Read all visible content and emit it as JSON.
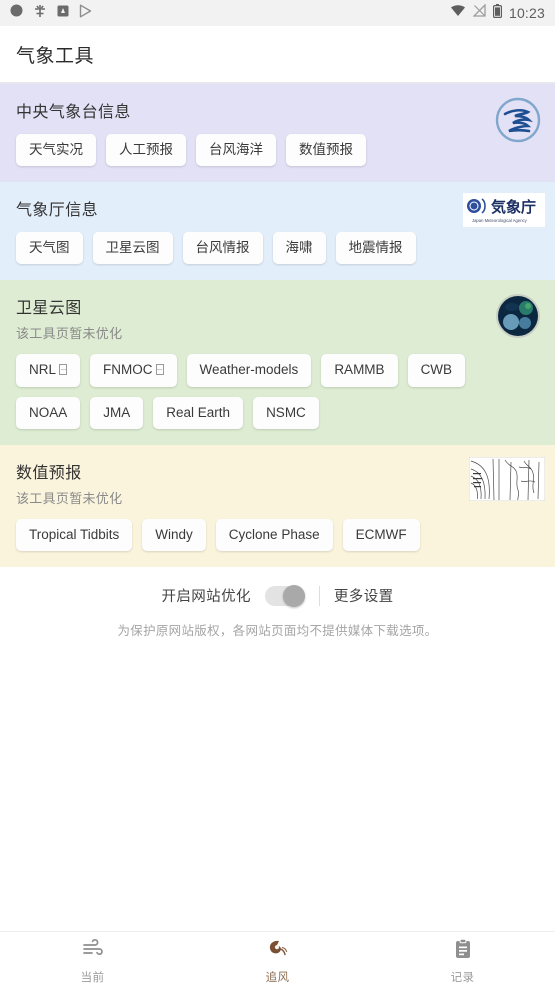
{
  "statusbar": {
    "time": "10:23",
    "left_icons": [
      "circle-dot-icon",
      "app-glyph-icon",
      "app-badge-icon",
      "play-store-icon"
    ],
    "right_icons": [
      "wifi-icon",
      "signal-off-icon",
      "battery-icon"
    ]
  },
  "appbar": {
    "title": "气象工具"
  },
  "sections": [
    {
      "id": "cma",
      "title": "中央气象台信息",
      "subtitle": "",
      "logo": "cma-dragon-logo",
      "bg": "#e3e1f5",
      "chips": [
        {
          "label": "天气实况"
        },
        {
          "label": "人工预报"
        },
        {
          "label": "台风海洋"
        },
        {
          "label": "数值预报"
        }
      ]
    },
    {
      "id": "jma",
      "title": "气象厅信息",
      "subtitle": "",
      "logo": "jma-logo",
      "bg": "#e3eefb",
      "chips": [
        {
          "label": "天气图"
        },
        {
          "label": "卫星云图"
        },
        {
          "label": "台风情报"
        },
        {
          "label": "海啸"
        },
        {
          "label": "地震情报"
        }
      ]
    },
    {
      "id": "satellite",
      "title": "卫星云图",
      "subtitle": "该工具页暂未优化",
      "logo": "earth-globe-icon",
      "bg": "#ddecd2",
      "chips": [
        {
          "label": "NRL",
          "tofu": true
        },
        {
          "label": "FNMOC",
          "tofu": true
        },
        {
          "label": "Weather-models"
        },
        {
          "label": "RAMMB"
        },
        {
          "label": "CWB"
        },
        {
          "label": "NOAA"
        },
        {
          "label": "JMA"
        },
        {
          "label": "Real Earth"
        },
        {
          "label": "NSMC"
        }
      ]
    },
    {
      "id": "numerical",
      "title": "数值预报",
      "subtitle": "该工具页暂未优化",
      "logo": "weather-chart-thumbnail",
      "bg": "#fbf4dd",
      "chips": [
        {
          "label": "Tropical Tidbits"
        },
        {
          "label": "Windy"
        },
        {
          "label": "Cyclone Phase"
        },
        {
          "label": "ECMWF"
        }
      ]
    }
  ],
  "settings": {
    "toggle_label": "开启网站优化",
    "toggle_on": false,
    "more_label": "更多设置",
    "note": "为保护原网站版权，各网站页面均不提供媒体下载选项。"
  },
  "bottomnav": {
    "active_index": 1,
    "items": [
      {
        "label": "当前",
        "icon": "wind-icon"
      },
      {
        "label": "追风",
        "icon": "typhoon-icon"
      },
      {
        "label": "记录",
        "icon": "clipboard-icon"
      }
    ]
  },
  "colors": {
    "accent": "#8d6e52",
    "purple": "#e3e1f5",
    "blue": "#e3eefb",
    "green": "#ddecd2",
    "cream": "#fbf4dd"
  }
}
